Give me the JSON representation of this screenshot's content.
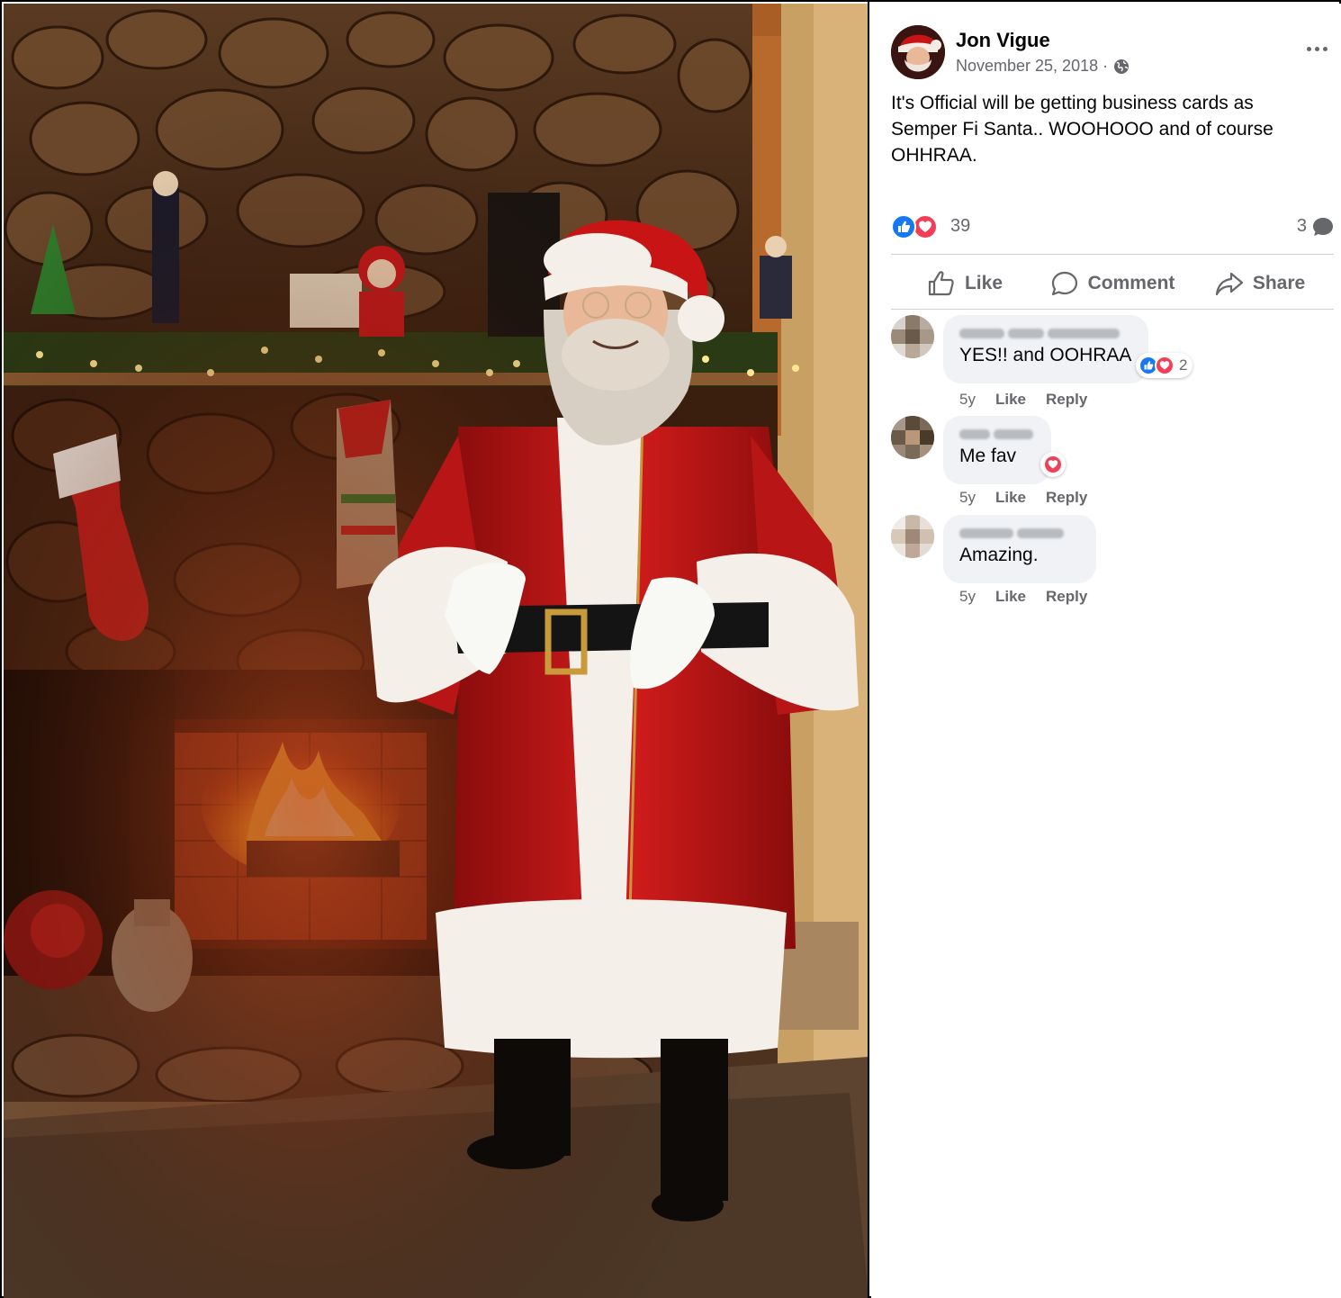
{
  "post": {
    "author": "Jon Vigue",
    "date": "November 25, 2018 ·",
    "privacy_icon": "globe-icon",
    "text": "It's Official will be getting business cards as Semper Fi Santa.. WOOHOOO and of course OHHRAA.",
    "reactions": {
      "types": [
        "like",
        "love"
      ],
      "count": "39"
    },
    "comment_count": "3"
  },
  "actions": {
    "like": "Like",
    "comment": "Comment",
    "share": "Share"
  },
  "comments": [
    {
      "text": "YES!! and OOHRAA",
      "age": "5y",
      "like": "Like",
      "reply": "Reply",
      "reactions": [
        "like",
        "love"
      ],
      "reaction_count": "2"
    },
    {
      "text": "Me fav",
      "age": "5y",
      "like": "Like",
      "reply": "Reply",
      "reactions": [
        "love"
      ]
    },
    {
      "text": "Amazing.",
      "age": "5y",
      "like": "Like",
      "reply": "Reply",
      "reactions": []
    }
  ],
  "colors": {
    "like_blue": "#1877f2",
    "love_red": "#f33e58",
    "secondary_text": "#65676b",
    "comment_bg": "#f0f2f5"
  }
}
